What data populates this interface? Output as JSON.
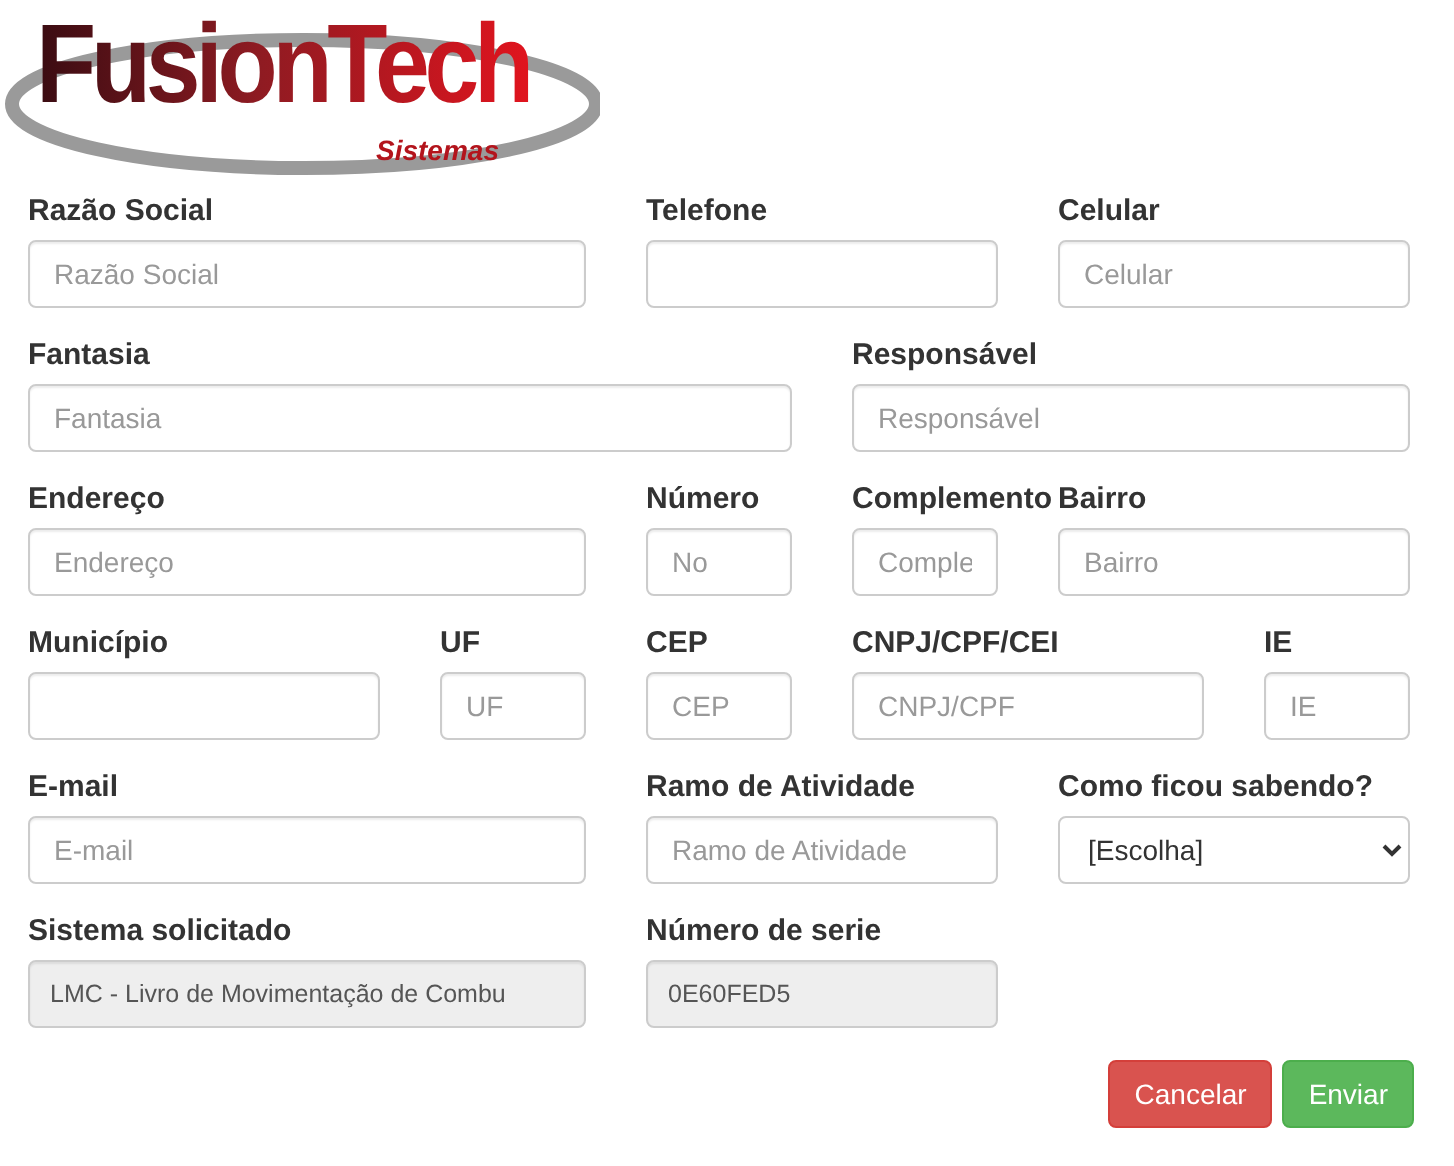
{
  "logo": {
    "name": "FusionTech",
    "tagline": "Sistemas"
  },
  "fields": [
    {
      "label": "Razão Social",
      "kind": "text",
      "placeholder": "Razão Social"
    },
    {
      "label": "Telefone",
      "kind": "text"
    },
    {
      "label": "Celular",
      "kind": "text",
      "placeholder": "Celular"
    },
    {
      "label": "Fantasia",
      "kind": "text",
      "placeholder": "Fantasia"
    },
    {
      "label": "Responsável",
      "kind": "text",
      "placeholder": "Responsável"
    },
    {
      "label": "Endereço",
      "kind": "text",
      "placeholder": "Endereço"
    },
    {
      "label": "Número",
      "kind": "text",
      "placeholder": "No"
    },
    {
      "label": "Complemento",
      "kind": "text",
      "placeholder": "Comple"
    },
    {
      "label": "Bairro",
      "kind": "text",
      "placeholder": "Bairro"
    },
    {
      "label": "Município",
      "kind": "text"
    },
    {
      "label": "UF",
      "kind": "text",
      "placeholder": "UF"
    },
    {
      "label": "CEP",
      "kind": "text",
      "placeholder": "CEP"
    },
    {
      "label": "CNPJ/CPF/CEI",
      "kind": "text",
      "placeholder": "CNPJ/CPF"
    },
    {
      "label": "IE",
      "kind": "text",
      "placeholder": "IE"
    },
    {
      "label": "E-mail",
      "kind": "text",
      "placeholder": "E-mail"
    },
    {
      "label": "Ramo de Atividade",
      "kind": "text",
      "placeholder": "Ramo de Atividade"
    },
    {
      "label": "Como ficou sabendo?",
      "kind": "select",
      "value": "[Escolha]"
    },
    {
      "label": "Sistema solicitado",
      "kind": "readonly",
      "value": "LMC - Livro de Movimentação de Combu"
    },
    {
      "label": "Número de serie",
      "kind": "readonly",
      "value": "0E60FED5"
    }
  ],
  "buttons": [
    {
      "label": "Cancelar",
      "kind": "danger"
    },
    {
      "label": "Enviar",
      "kind": "success"
    }
  ]
}
